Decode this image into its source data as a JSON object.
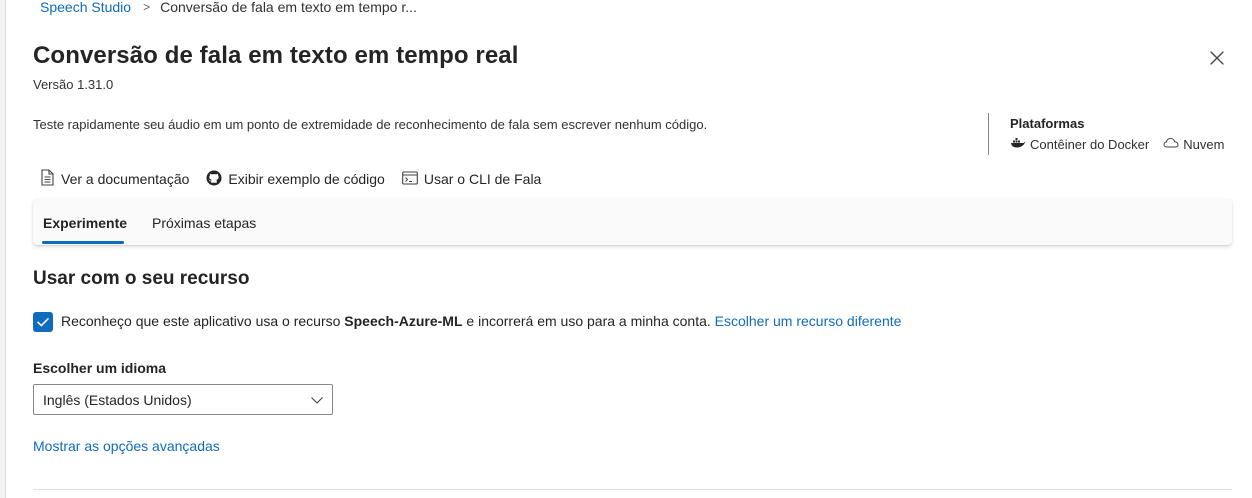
{
  "breadcrumb": {
    "root": "Speech Studio",
    "separator": ">",
    "current": "Conversão de fala em texto em tempo r..."
  },
  "header": {
    "title": "Conversão de fala em texto em tempo real",
    "version": "Versão 1.31.0",
    "close_icon": "close-icon"
  },
  "description": "Teste rapidamente seu áudio em um ponto de extremidade de reconhecimento de fala sem escrever nenhum código.",
  "platforms": {
    "title": "Plataformas",
    "items": [
      {
        "label": "Contêiner do Docker",
        "icon": "docker-icon"
      },
      {
        "label": "Nuvem",
        "icon": "cloud-icon"
      }
    ]
  },
  "links": [
    {
      "label": "Ver a documentação",
      "icon": "document-icon"
    },
    {
      "label": "Exibir exemplo de código",
      "icon": "github-icon"
    },
    {
      "label": "Usar o CLI de Fala",
      "icon": "terminal-icon"
    }
  ],
  "tabs": [
    {
      "label": "Experimente",
      "active": true
    },
    {
      "label": "Próximas etapas",
      "active": false
    }
  ],
  "resource_section": {
    "title": "Usar com o seu recurso",
    "consent_prefix": "Reconheço que este aplicativo usa o recurso ",
    "resource_name": "Speech-Azure-ML",
    "consent_suffix": " e incorrerá em uso para a minha conta. ",
    "change_link": "Escolher um recurso diferente",
    "checked": true
  },
  "language": {
    "label": "Escolher um idioma",
    "selected": "Inglês (Estados Unidos)"
  },
  "advanced_link": "Mostrar as opções avançadas",
  "colors": {
    "accent": "#0f6cbd",
    "text": "#242424",
    "tab_bar_bg": "#fafafa"
  }
}
